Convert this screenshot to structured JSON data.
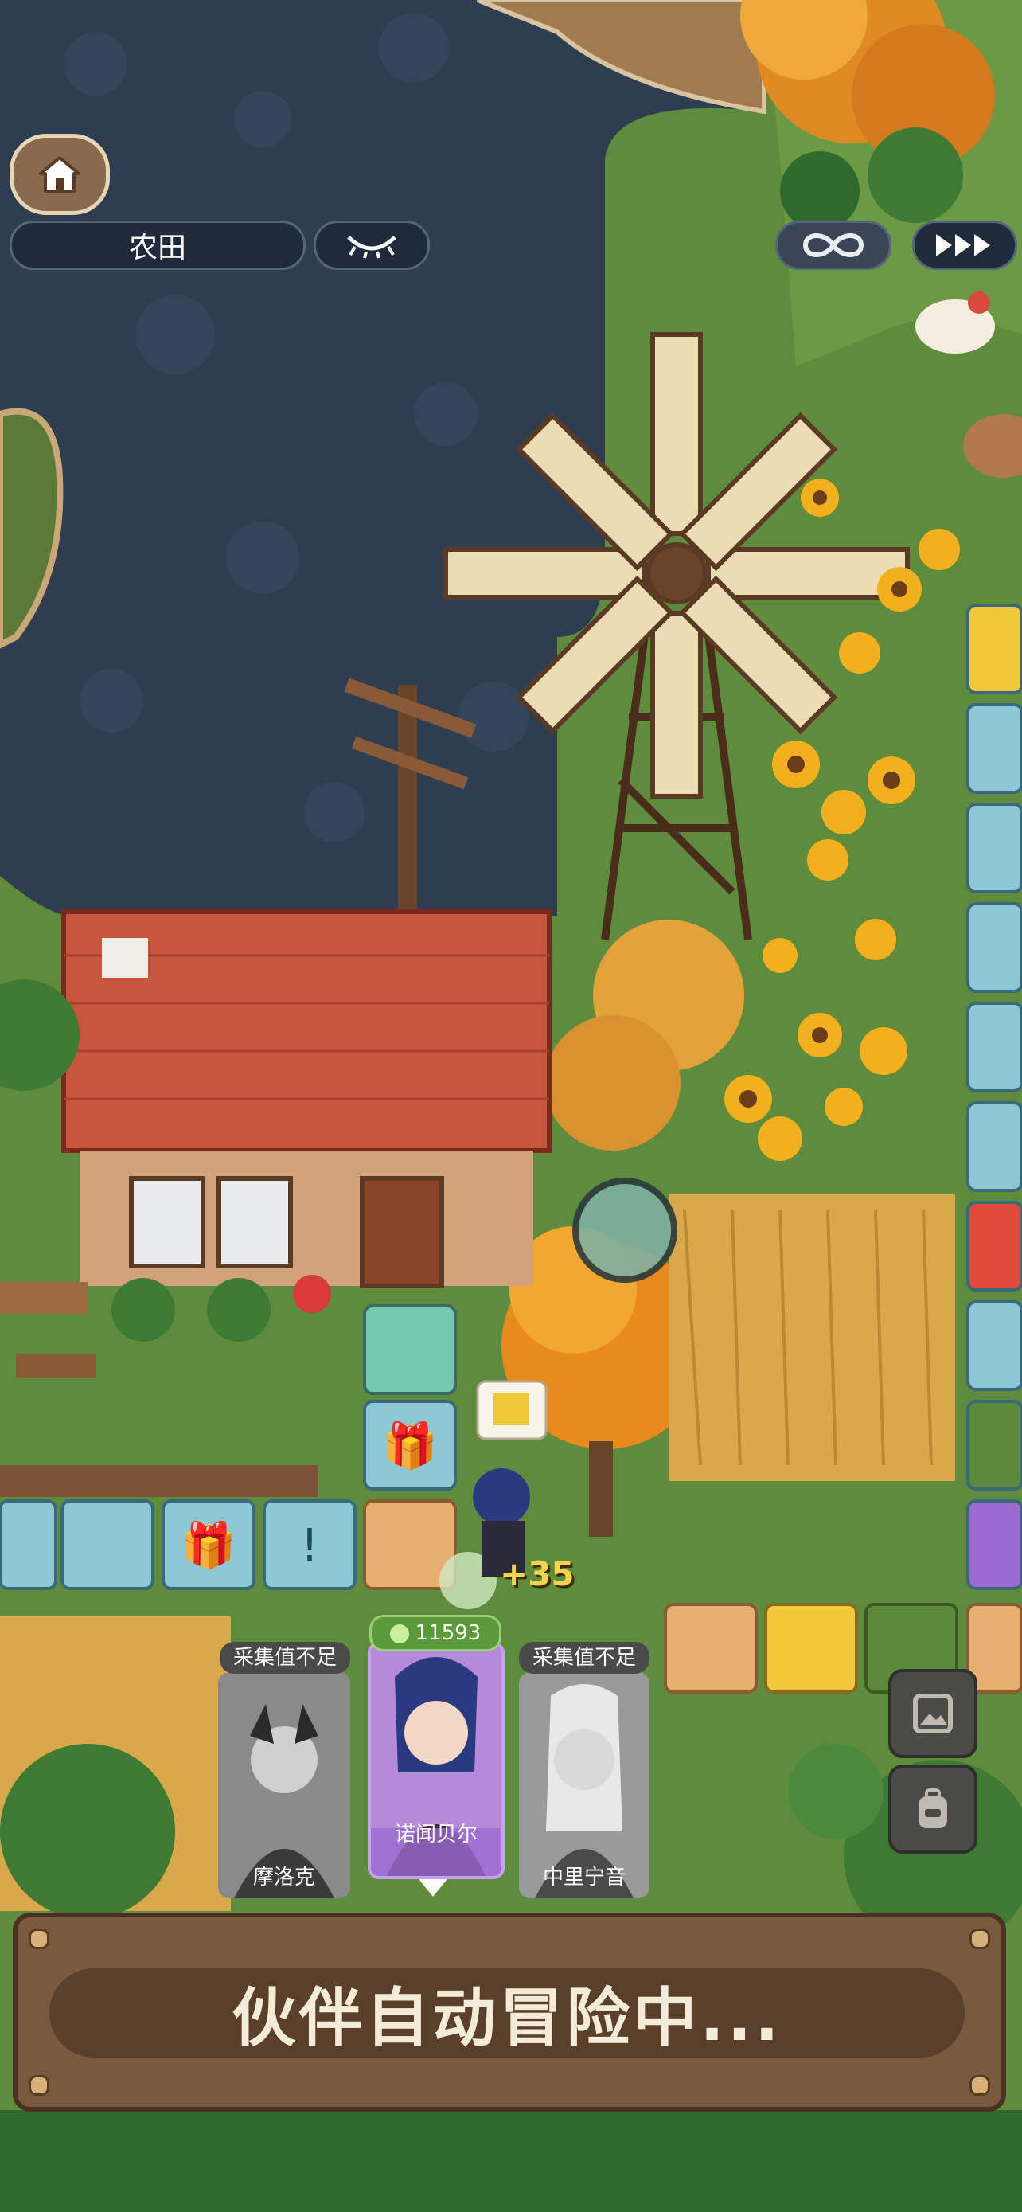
{
  "hud": {
    "location_label": "农田",
    "home_icon": "home-icon",
    "eye_icon": "closed-eye-icon",
    "loop_icon": "infinity-icon",
    "speed_icon": "fast-forward-icon"
  },
  "floating": {
    "plus_value": "+35"
  },
  "party": [
    {
      "tag": "采集值不足",
      "name": "摩洛克",
      "selected": false
    },
    {
      "tag": "11593",
      "name": "诺闻贝尔",
      "selected": true
    },
    {
      "tag": "采集值不足",
      "name": "中里宁音",
      "selected": false
    }
  ],
  "side_buttons": {
    "gallery_icon": "picture-icon",
    "bag_icon": "backpack-icon"
  },
  "banner": {
    "status_text": "伙伴自动冒险中..."
  },
  "colors": {
    "water": "#2b3a4c",
    "grass": "#5d8a3a",
    "path_tile": "#8ec8d4",
    "roof": "#c8563e",
    "selected_card": "#9a6ad0",
    "banner_wood": "#7a5a3e"
  }
}
